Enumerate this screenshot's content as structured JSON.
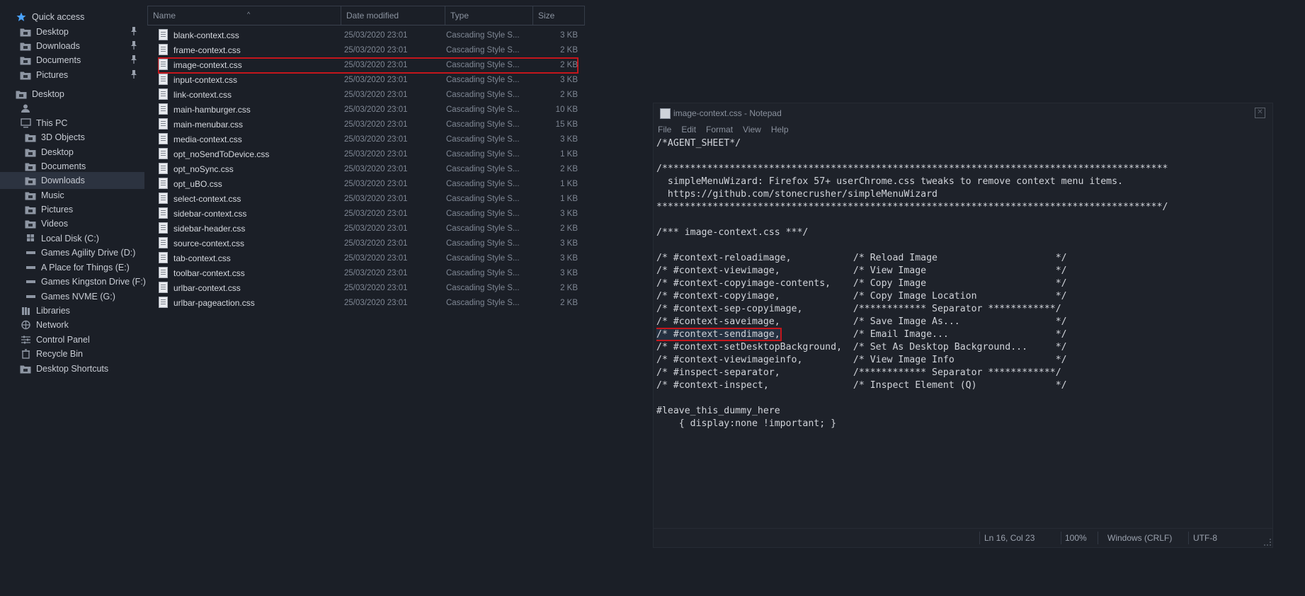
{
  "nav": {
    "items": [
      {
        "label": "Quick access",
        "icon": "star-icon",
        "pinned": false,
        "indent": 0
      },
      {
        "label": "Desktop",
        "icon": "desktop-folder-icon",
        "pinned": true,
        "indent": 1
      },
      {
        "label": "Downloads",
        "icon": "downloads-folder-icon",
        "pinned": true,
        "indent": 1
      },
      {
        "label": "Documents",
        "icon": "documents-folder-icon",
        "pinned": true,
        "indent": 1
      },
      {
        "label": "Pictures",
        "icon": "pictures-folder-icon",
        "pinned": true,
        "indent": 1
      },
      {
        "label": "Desktop",
        "icon": "desktop-folder-icon",
        "pinned": false,
        "indent": 0
      },
      {
        "label": "",
        "icon": "user-icon",
        "pinned": false,
        "indent": 1
      },
      {
        "label": "This PC",
        "icon": "computer-icon",
        "pinned": false,
        "indent": 1
      },
      {
        "label": "3D Objects",
        "icon": "3d-objects-folder-icon",
        "pinned": false,
        "indent": 2
      },
      {
        "label": "Desktop",
        "icon": "desktop-folder-icon",
        "pinned": false,
        "indent": 2
      },
      {
        "label": "Documents",
        "icon": "documents-folder-icon",
        "pinned": false,
        "indent": 2
      },
      {
        "label": "Downloads",
        "icon": "downloads-folder-icon",
        "pinned": false,
        "indent": 2,
        "selected": true
      },
      {
        "label": "Music",
        "icon": "music-folder-icon",
        "pinned": false,
        "indent": 2
      },
      {
        "label": "Pictures",
        "icon": "pictures-folder-icon",
        "pinned": false,
        "indent": 2
      },
      {
        "label": "Videos",
        "icon": "videos-folder-icon",
        "pinned": false,
        "indent": 2
      },
      {
        "label": "Local Disk (C:)",
        "icon": "windows-drive-icon",
        "pinned": false,
        "indent": 2
      },
      {
        "label": "Games Agility Drive (D:)",
        "icon": "drive-icon",
        "pinned": false,
        "indent": 2
      },
      {
        "label": "A Place for Things (E:)",
        "icon": "drive-icon",
        "pinned": false,
        "indent": 2
      },
      {
        "label": "Games Kingston Drive (F:)",
        "icon": "drive-icon",
        "pinned": false,
        "indent": 2
      },
      {
        "label": "Games NVME (G:)",
        "icon": "drive-icon",
        "pinned": false,
        "indent": 2
      },
      {
        "label": "Libraries",
        "icon": "libraries-icon",
        "pinned": false,
        "indent": 1
      },
      {
        "label": "Network",
        "icon": "network-icon",
        "pinned": false,
        "indent": 1
      },
      {
        "label": "Control Panel",
        "icon": "control-panel-icon",
        "pinned": false,
        "indent": 1
      },
      {
        "label": "Recycle Bin",
        "icon": "recycle-bin-icon",
        "pinned": false,
        "indent": 1
      },
      {
        "label": "Desktop Shortcuts",
        "icon": "folder-icon",
        "pinned": false,
        "indent": 1
      }
    ]
  },
  "filelist": {
    "columns": {
      "name": "Name",
      "date": "Date modified",
      "type": "Type",
      "size": "Size"
    },
    "files": [
      {
        "name": "blank-context.css",
        "date": "25/03/2020 23:01",
        "type": "Cascading Style S...",
        "size": "3 KB"
      },
      {
        "name": "frame-context.css",
        "date": "25/03/2020 23:01",
        "type": "Cascading Style S...",
        "size": "2 KB"
      },
      {
        "name": "image-context.css",
        "date": "25/03/2020 23:01",
        "type": "Cascading Style S...",
        "size": "2 KB",
        "highlighted": true
      },
      {
        "name": "input-context.css",
        "date": "25/03/2020 23:01",
        "type": "Cascading Style S...",
        "size": "3 KB"
      },
      {
        "name": "link-context.css",
        "date": "25/03/2020 23:01",
        "type": "Cascading Style S...",
        "size": "2 KB"
      },
      {
        "name": "main-hamburger.css",
        "date": "25/03/2020 23:01",
        "type": "Cascading Style S...",
        "size": "10 KB"
      },
      {
        "name": "main-menubar.css",
        "date": "25/03/2020 23:01",
        "type": "Cascading Style S...",
        "size": "15 KB"
      },
      {
        "name": "media-context.css",
        "date": "25/03/2020 23:01",
        "type": "Cascading Style S...",
        "size": "3 KB"
      },
      {
        "name": "opt_noSendToDevice.css",
        "date": "25/03/2020 23:01",
        "type": "Cascading Style S...",
        "size": "1 KB"
      },
      {
        "name": "opt_noSync.css",
        "date": "25/03/2020 23:01",
        "type": "Cascading Style S...",
        "size": "2 KB"
      },
      {
        "name": "opt_uBO.css",
        "date": "25/03/2020 23:01",
        "type": "Cascading Style S...",
        "size": "1 KB"
      },
      {
        "name": "select-context.css",
        "date": "25/03/2020 23:01",
        "type": "Cascading Style S...",
        "size": "1 KB"
      },
      {
        "name": "sidebar-context.css",
        "date": "25/03/2020 23:01",
        "type": "Cascading Style S...",
        "size": "3 KB"
      },
      {
        "name": "sidebar-header.css",
        "date": "25/03/2020 23:01",
        "type": "Cascading Style S...",
        "size": "2 KB"
      },
      {
        "name": "source-context.css",
        "date": "25/03/2020 23:01",
        "type": "Cascading Style S...",
        "size": "3 KB"
      },
      {
        "name": "tab-context.css",
        "date": "25/03/2020 23:01",
        "type": "Cascading Style S...",
        "size": "3 KB"
      },
      {
        "name": "toolbar-context.css",
        "date": "25/03/2020 23:01",
        "type": "Cascading Style S...",
        "size": "3 KB"
      },
      {
        "name": "urlbar-context.css",
        "date": "25/03/2020 23:01",
        "type": "Cascading Style S...",
        "size": "2 KB"
      },
      {
        "name": "urlbar-pageaction.css",
        "date": "25/03/2020 23:01",
        "type": "Cascading Style S...",
        "size": "2 KB"
      }
    ]
  },
  "notepad": {
    "title": "image-context.css - Notepad",
    "menu": [
      "File",
      "Edit",
      "Format",
      "View",
      "Help"
    ],
    "lines": [
      "/*AGENT_SHEET*/",
      "",
      "/******************************************************************************************",
      "  simpleMenuWizard: Firefox 57+ userChrome.css tweaks to remove context menu items.",
      "  https://github.com/stonecrusher/simpleMenuWizard",
      "******************************************************************************************/",
      "",
      "/*** image-context.css ***/",
      "",
      "/* #context-reloadimage,           /* Reload Image                     */",
      "/* #context-viewimage,             /* View Image                       */",
      "/* #context-copyimage-contents,    /* Copy Image                       */",
      "/* #context-copyimage,             /* Copy Image Location              */",
      "/* #context-sep-copyimage,         /************ Separator ************/",
      "/* #context-saveimage,             /* Save Image As...                 */",
      "/* #context-sendimage,             /* Email Image...                   */",
      "/* #context-setDesktopBackground,  /* Set As Desktop Background...     */",
      "/* #context-viewimageinfo,         /* View Image Info                  */",
      "/* #inspect-separator,             /************ Separator ************/",
      "/* #context-inspect,               /* Inspect Element (Q)              */",
      "",
      "#leave_this_dummy_here",
      "    { display:none !important; }"
    ],
    "selected_text": "/* #context-sendimage,",
    "status": {
      "position": "Ln 16, Col 23",
      "zoom": "100%",
      "eol": "Windows (CRLF)",
      "encoding": "UTF-8"
    }
  },
  "colors": {
    "accent": "#c4161c",
    "background": "#1b1f27",
    "selected_nav": "#2c3340",
    "star": "#4aa3ff"
  }
}
